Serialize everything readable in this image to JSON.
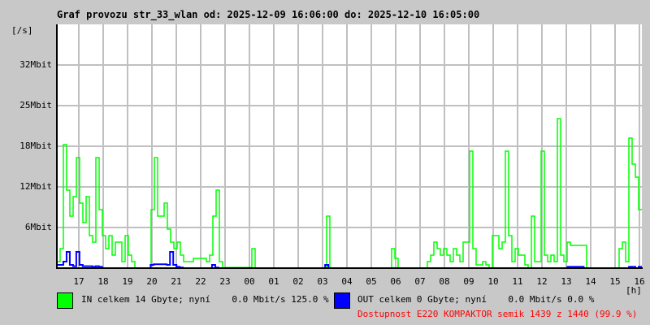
{
  "title": "Graf provozu str_33_wlan od: 2025-12-09 16:06:00 do: 2025-12-10 16:05:00",
  "y_unit": "[/s]",
  "x_unit": "[h]",
  "legend": {
    "in": {
      "text": "IN celkem 14 Gbyte; nyní    0.0 Mbit/s 125.0 %",
      "color": "#00ff00"
    },
    "out": {
      "text": "OUT celkem 0 Gbyte; nyní    0.0 Mbit/s 0.0 %",
      "color": "#0000ff"
    },
    "availability": "Dostupnost E220 KOMPAKTOR semik 1439 z 1440 (99.9 %)"
  },
  "chart_data": {
    "type": "line",
    "title": "Graf provozu str_33_wlan od: 2025-12-09 16:06:00 do: 2025-12-10 16:05:00",
    "xlabel": "[h]",
    "ylabel": "[/s]",
    "x_tick_labels": [
      "17",
      "18",
      "19",
      "20",
      "21",
      "22",
      "23",
      "00",
      "01",
      "02",
      "03",
      "04",
      "05",
      "06",
      "07",
      "08",
      "09",
      "10",
      "11",
      "12",
      "13",
      "14",
      "15",
      "16"
    ],
    "y_ticks": [
      {
        "label": "6Mbit",
        "value": 6.25
      },
      {
        "label": "12Mbit",
        "value": 12.5
      },
      {
        "label": "18Mbit",
        "value": 18.75
      },
      {
        "label": "25Mbit",
        "value": 25
      },
      {
        "label": "32Mbit",
        "value": 31.25
      }
    ],
    "ylim": [
      0,
      37.5
    ],
    "sample_minutes": 8,
    "grid": true,
    "series": [
      {
        "name": "IN",
        "color": "#00ff00",
        "values": [
          1,
          3,
          19,
          12,
          8,
          11,
          17,
          10,
          7,
          11,
          5,
          4,
          17,
          9,
          5,
          3,
          5,
          2,
          4,
          4,
          1,
          5,
          2,
          1,
          0,
          0,
          0,
          0,
          0,
          9,
          17,
          8,
          8,
          10,
          6,
          4,
          3,
          4,
          2,
          1,
          1,
          1,
          1.5,
          1.5,
          1.5,
          1.5,
          1,
          2,
          8,
          12,
          1,
          0,
          0.1,
          0.1,
          0.1,
          0.1,
          0.1,
          0.1,
          0.1,
          0.1,
          3,
          0,
          0,
          0,
          0,
          0,
          0,
          0,
          0,
          0,
          0,
          0,
          0,
          0,
          0,
          0,
          0,
          0,
          0,
          0,
          0,
          0,
          0,
          8,
          0,
          0,
          0,
          0,
          0,
          0,
          0,
          0,
          0,
          0,
          0,
          0,
          0,
          0,
          0,
          0,
          0,
          0,
          0,
          3,
          1.5,
          0,
          0,
          0,
          0,
          0,
          0,
          0,
          0,
          0,
          1,
          2,
          4,
          3,
          2,
          3,
          2,
          1,
          3,
          2,
          1,
          4,
          4,
          18,
          3,
          0.5,
          0.5,
          1,
          0.5,
          0,
          5,
          5,
          3,
          4,
          18,
          5,
          1,
          3,
          2,
          2,
          0.5,
          0,
          8,
          1,
          1,
          18,
          2,
          1,
          2,
          1,
          23,
          2,
          1,
          4,
          3.5,
          3.5,
          3.5,
          3.5,
          3.5,
          0,
          0,
          0,
          0,
          0,
          0,
          0,
          0,
          0,
          0,
          3,
          4,
          1,
          20,
          16,
          14,
          9
        ]
      },
      {
        "name": "OUT",
        "color": "#0000ff",
        "values": [
          0.5,
          0.5,
          1,
          2.5,
          0.5,
          0.3,
          2.5,
          0.5,
          0.3,
          0.3,
          0.3,
          0.2,
          0.3,
          0.2,
          0,
          0,
          0,
          0,
          0,
          0,
          0,
          0,
          0,
          0,
          0,
          0,
          0,
          0,
          0,
          0.5,
          0.6,
          0.6,
          0.6,
          0.6,
          0.5,
          2.5,
          0.5,
          0.2,
          0.1,
          0,
          0,
          0,
          0,
          0,
          0,
          0,
          0,
          0,
          0.5,
          0.1,
          0,
          0,
          0,
          0,
          0,
          0,
          0,
          0,
          0,
          0,
          0,
          0,
          0,
          0,
          0,
          0,
          0,
          0,
          0,
          0,
          0,
          0,
          0,
          0,
          0,
          0,
          0,
          0,
          0,
          0,
          0,
          0,
          0,
          0.5,
          0,
          0,
          0,
          0,
          0,
          0,
          0,
          0,
          0,
          0,
          0,
          0,
          0,
          0,
          0,
          0,
          0,
          0,
          0,
          0,
          0,
          0,
          0,
          0,
          0,
          0,
          0,
          0,
          0,
          0,
          0,
          0,
          0,
          0,
          0,
          0,
          0,
          0,
          0,
          0,
          0,
          0,
          0,
          0,
          0,
          0,
          0,
          0,
          0,
          0,
          0,
          0,
          0,
          0,
          0,
          0,
          0,
          0,
          0,
          0,
          0,
          0,
          0,
          0,
          0,
          0,
          0,
          0,
          0,
          0,
          0,
          0,
          0,
          0,
          0.2,
          0.2,
          0.2,
          0.2,
          0.2,
          0,
          0,
          0,
          0,
          0,
          0,
          0,
          0,
          0,
          0,
          0,
          0,
          0,
          0,
          0.2,
          0.2,
          0,
          0.2
        ]
      }
    ]
  }
}
